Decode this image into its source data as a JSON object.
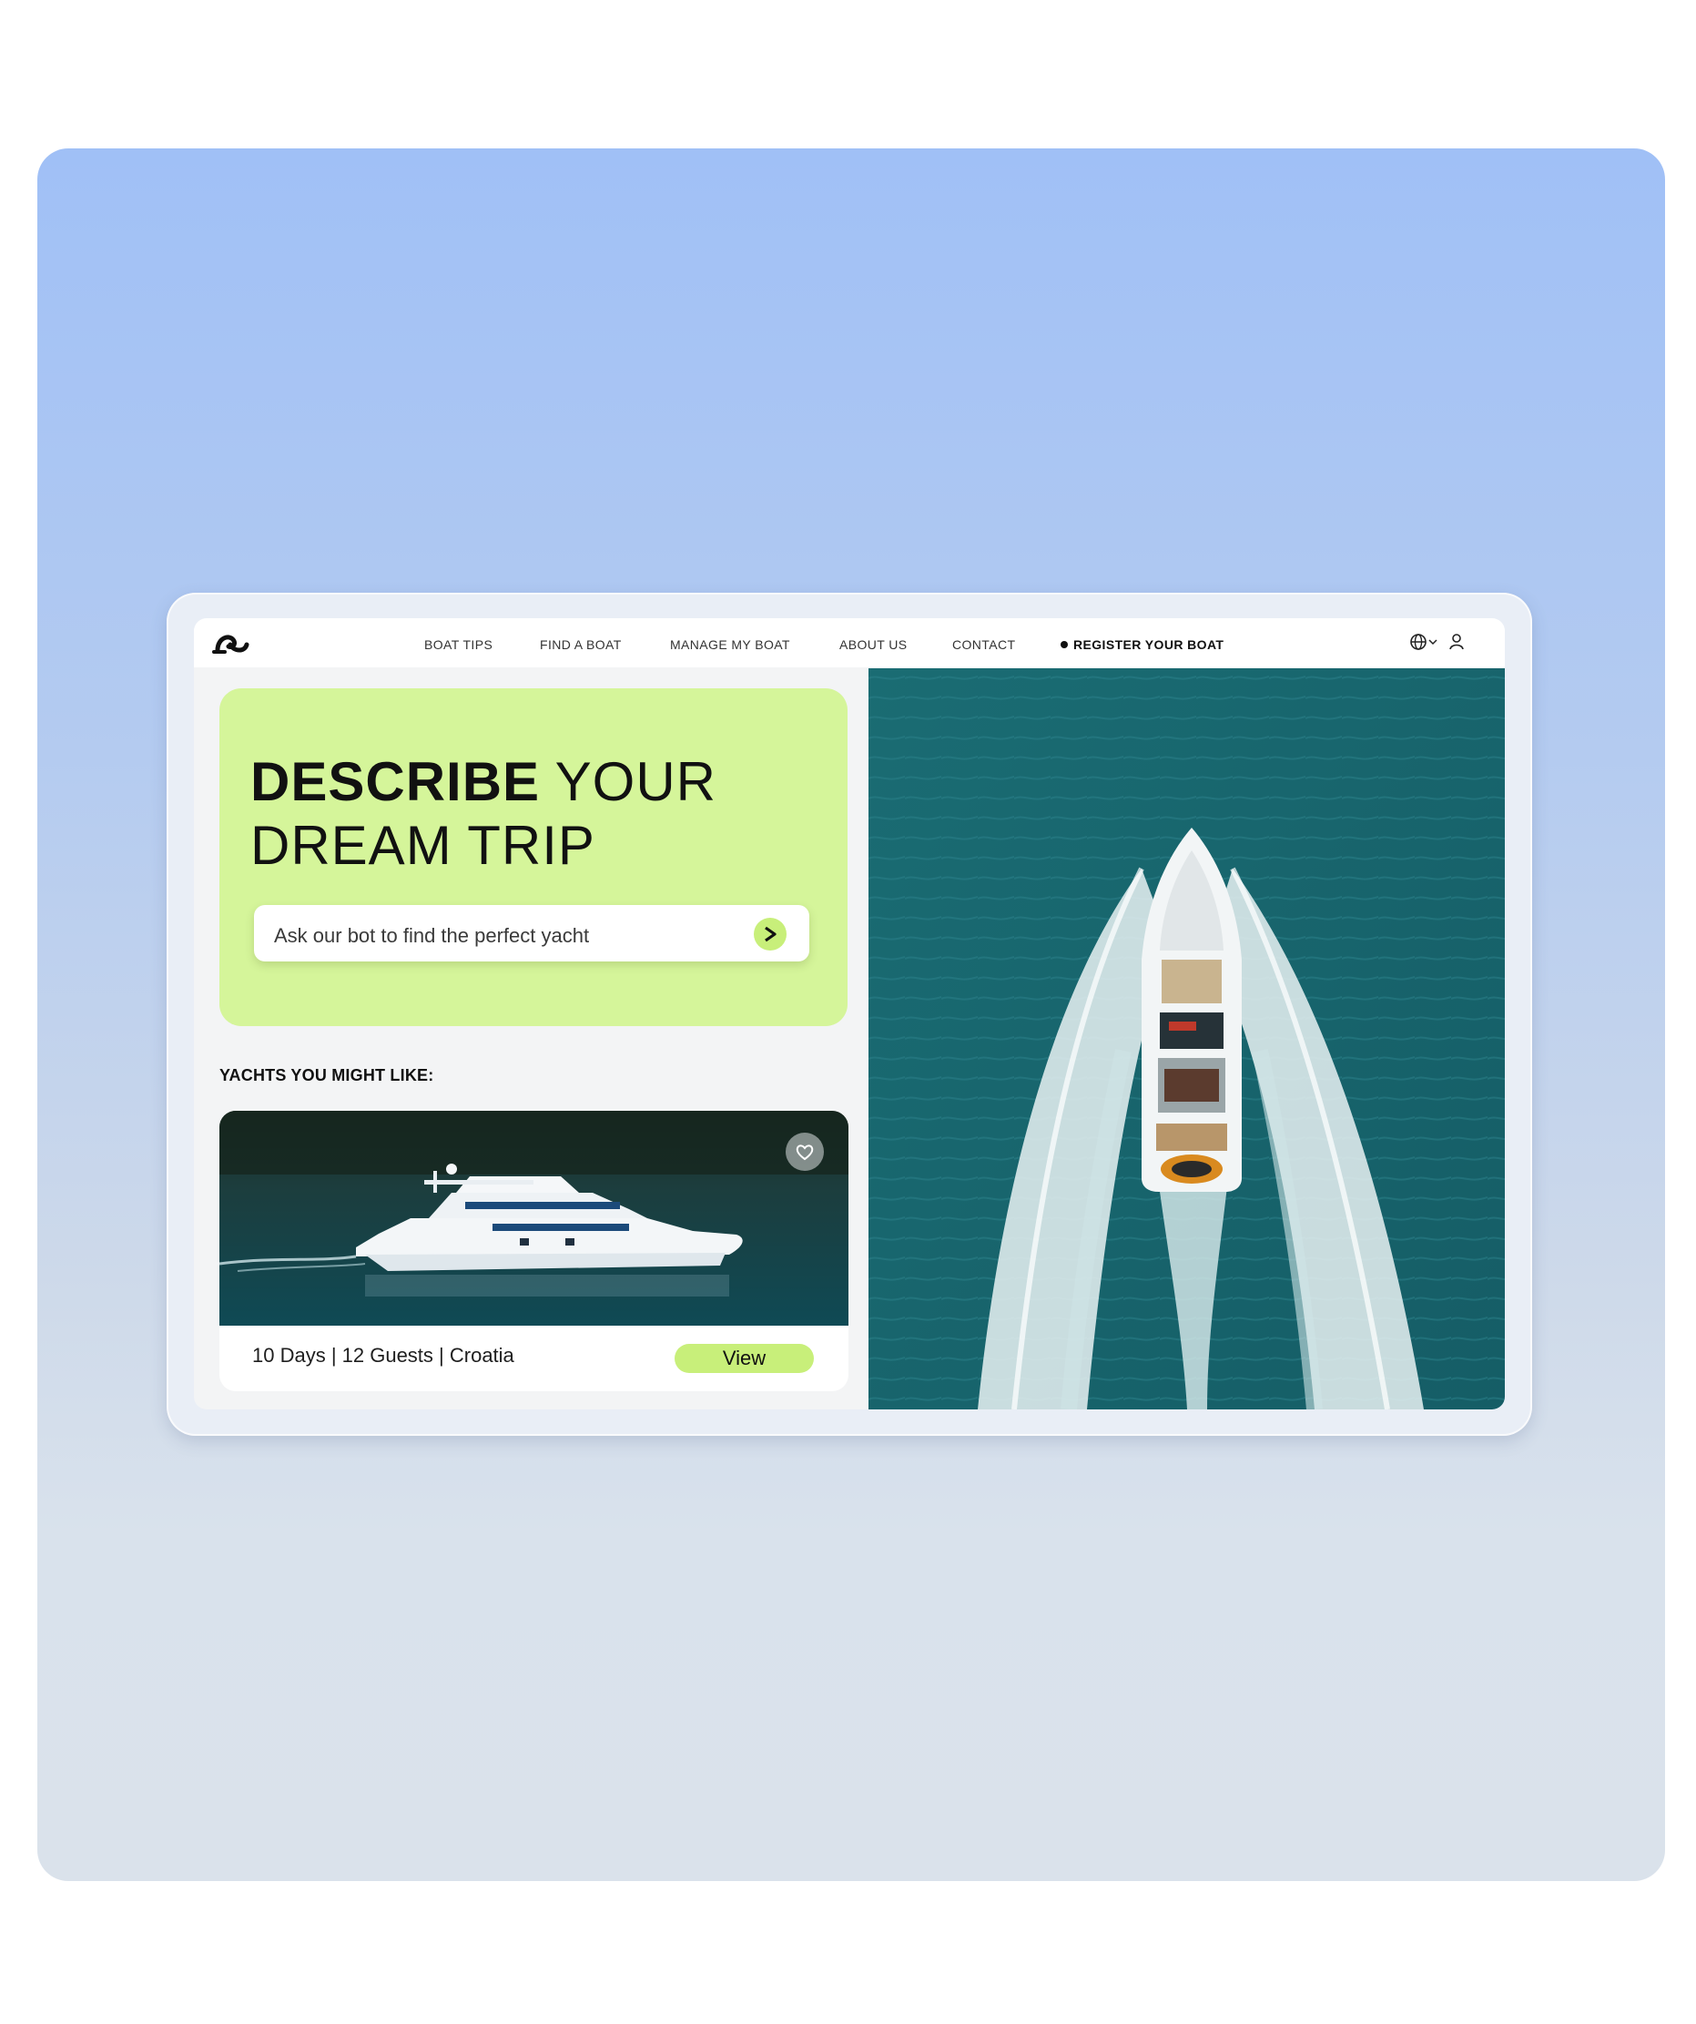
{
  "nav": {
    "items": [
      "BOAT TIPS",
      "FIND A BOAT",
      "MANAGE MY BOAT",
      "ABOUT US",
      "CONTACT"
    ],
    "register_label": "REGISTER YOUR BOAT",
    "icons": [
      "globe-icon",
      "chevron-down-icon",
      "user-icon"
    ],
    "logo": "logo"
  },
  "hero": {
    "headline_bold": "DESCRIBE",
    "headline_rest_1": "YOUR",
    "headline_rest_2": "DREAM TRIP",
    "search_placeholder": "Ask our bot to find the perfect yacht",
    "send_icon": "send-arrow-icon"
  },
  "recommendations": {
    "title": "YACHTS YOU MIGHT LIKE:",
    "card": {
      "info": "10 Days | 12 Guests | Croatia",
      "view_label": "View",
      "favorite_icon": "heart-icon"
    }
  },
  "colors": {
    "accent": "#d5f59a",
    "button": "#c8ef7a",
    "water": "#1b6a72",
    "backdrop_top": "#a0c0f6",
    "backdrop_bottom": "#dae2eb"
  }
}
